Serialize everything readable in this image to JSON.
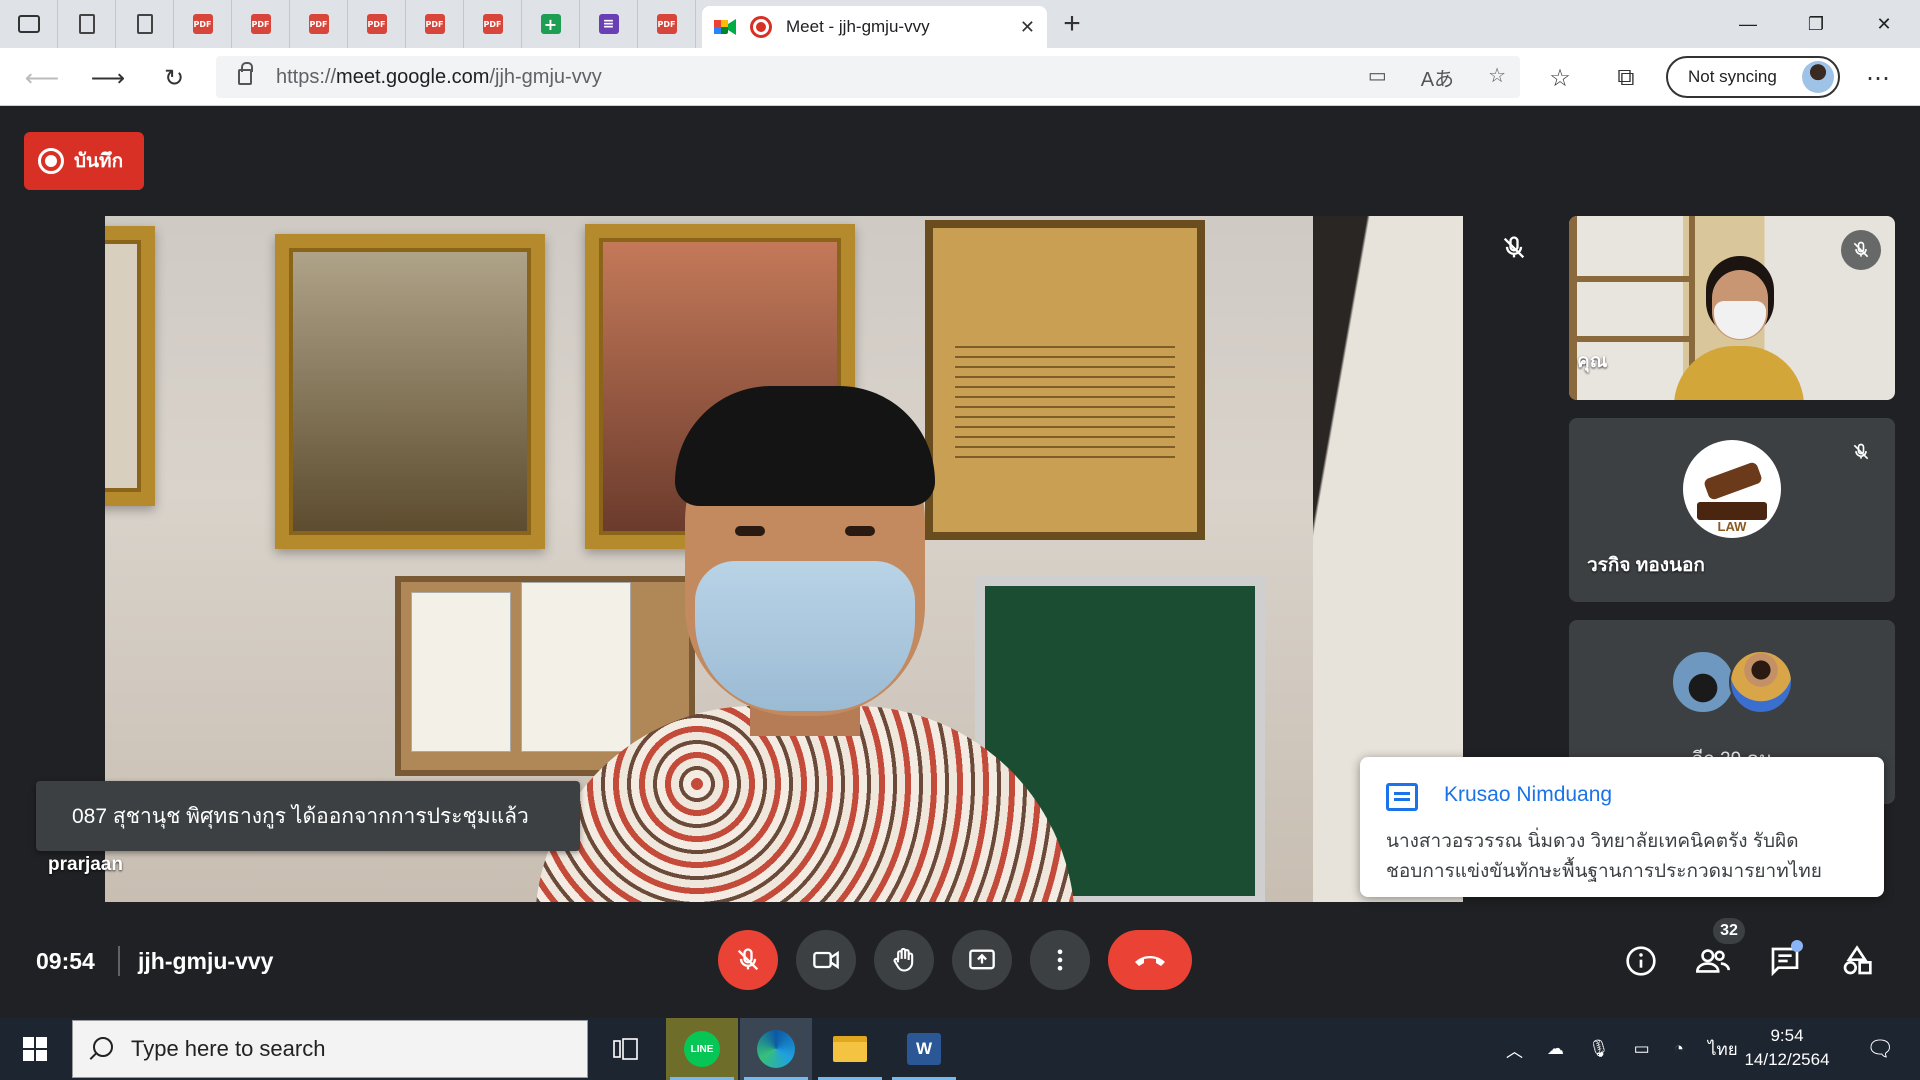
{
  "browser": {
    "tabs": [
      {
        "icon": "window-icon"
      },
      {
        "icon": "document-icon"
      },
      {
        "icon": "document-icon"
      },
      {
        "icon": "pdf-icon",
        "label": "PDF"
      },
      {
        "icon": "pdf-icon",
        "label": "PDF"
      },
      {
        "icon": "pdf-icon",
        "label": "PDF"
      },
      {
        "icon": "pdf-icon",
        "label": "PDF"
      },
      {
        "icon": "pdf-icon",
        "label": "PDF"
      },
      {
        "icon": "pdf-icon",
        "label": "PDF"
      },
      {
        "icon": "sheets-icon"
      },
      {
        "icon": "forms-icon"
      },
      {
        "icon": "pdf-icon",
        "label": "PDF"
      }
    ],
    "active_tab_title": "Meet - jjh-gmju-vvy",
    "url_prefix": "https://",
    "url_host": "meet.google.com",
    "url_path": "/jjh-gmju-vvy",
    "sync_label": "Not syncing",
    "translate_glyph": "Aあ"
  },
  "meet": {
    "record_label": "บันทึก",
    "toast_text": "087 สุชานุช พิศุทธางกูร ได้ออกจากการประชุมแล้ว",
    "main_speaker": "prarjaan",
    "tiles": [
      {
        "name": "คุณ"
      },
      {
        "name": "วรกิจ ทองนอก",
        "avatar_text": "LAW"
      },
      {
        "more_text": "อีก 29 คน"
      }
    ],
    "chat": {
      "sender": "Krusao Nimduang",
      "line1": "นางสาวอรวรรณ นิ่มดวง  วิทยาลัยเทคนิคตรัง รับผิด",
      "line2": "ชอบการแข่งขันทักษะพื้นฐานการประกวดมารยาทไทย"
    },
    "time": "09:54",
    "meeting_code": "jjh-gmju-vvy",
    "participants_count": "32",
    "colors": {
      "red": "#ea4335",
      "bg": "#202124",
      "control": "#3c4043",
      "accent": "#1a73e8"
    }
  },
  "taskbar": {
    "search_placeholder": "Type here to search",
    "line_label": "LINE",
    "word_label": "W",
    "lang": "ไทย",
    "clock_time": "9:54",
    "clock_date": "14/12/2564"
  }
}
